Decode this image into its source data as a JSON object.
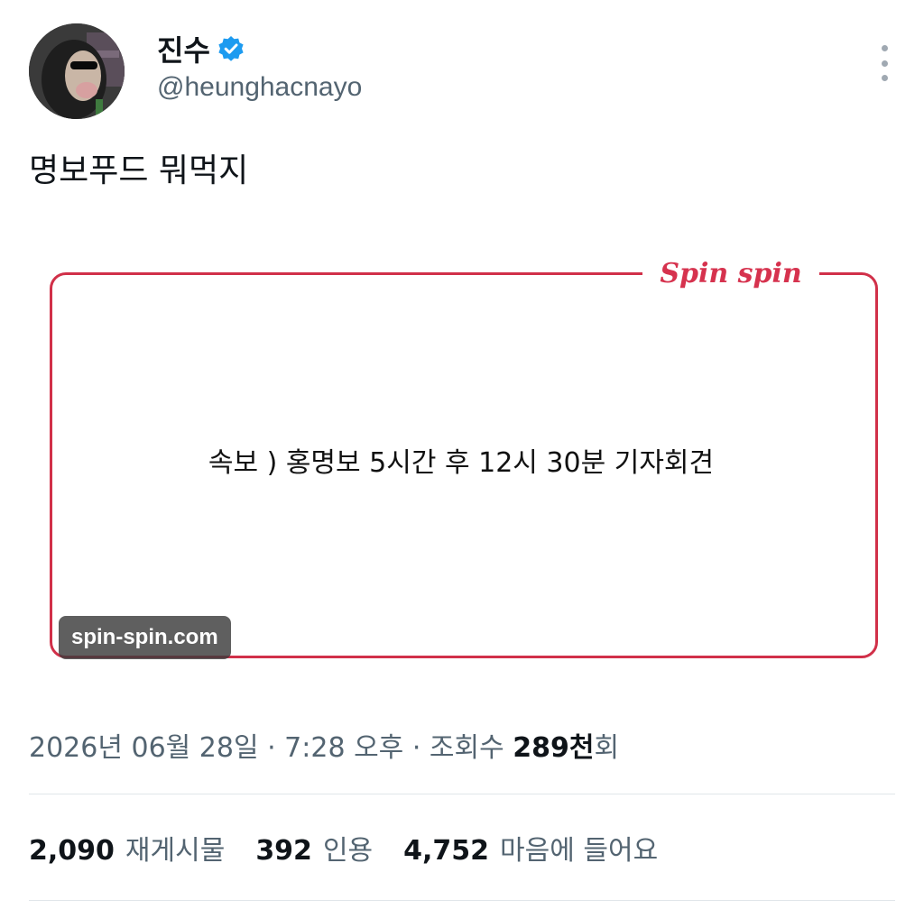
{
  "author": {
    "display_name": "진수",
    "handle": "@heunghacnayo",
    "verified_icon": "verified-badge-icon",
    "avatar_icon": "avatar"
  },
  "more_icon": "more-vertical-icon",
  "tweet": {
    "text": "명보푸드 뭐먹지"
  },
  "media": {
    "brand": "Spin spin",
    "headline": "속보 ) 홍명보 5시간 후 12시 30분 기자회견",
    "watermark": "spin-spin.com",
    "frame_color": "#d13049"
  },
  "meta": {
    "datetime": "2026년 06월 28일 · 7:28 오후 · 조회수 ",
    "views_count": "289천",
    "views_suffix": "회"
  },
  "stats": {
    "retweets_count": "2,090",
    "retweets_label": "재게시물",
    "quotes_count": "392",
    "quotes_label": "인용",
    "likes_count": "4,752",
    "likes_label": "마음에 들어요"
  },
  "colors": {
    "accent": "#1d9bf0",
    "muted": "#536471",
    "brand_red": "#d6324e"
  }
}
